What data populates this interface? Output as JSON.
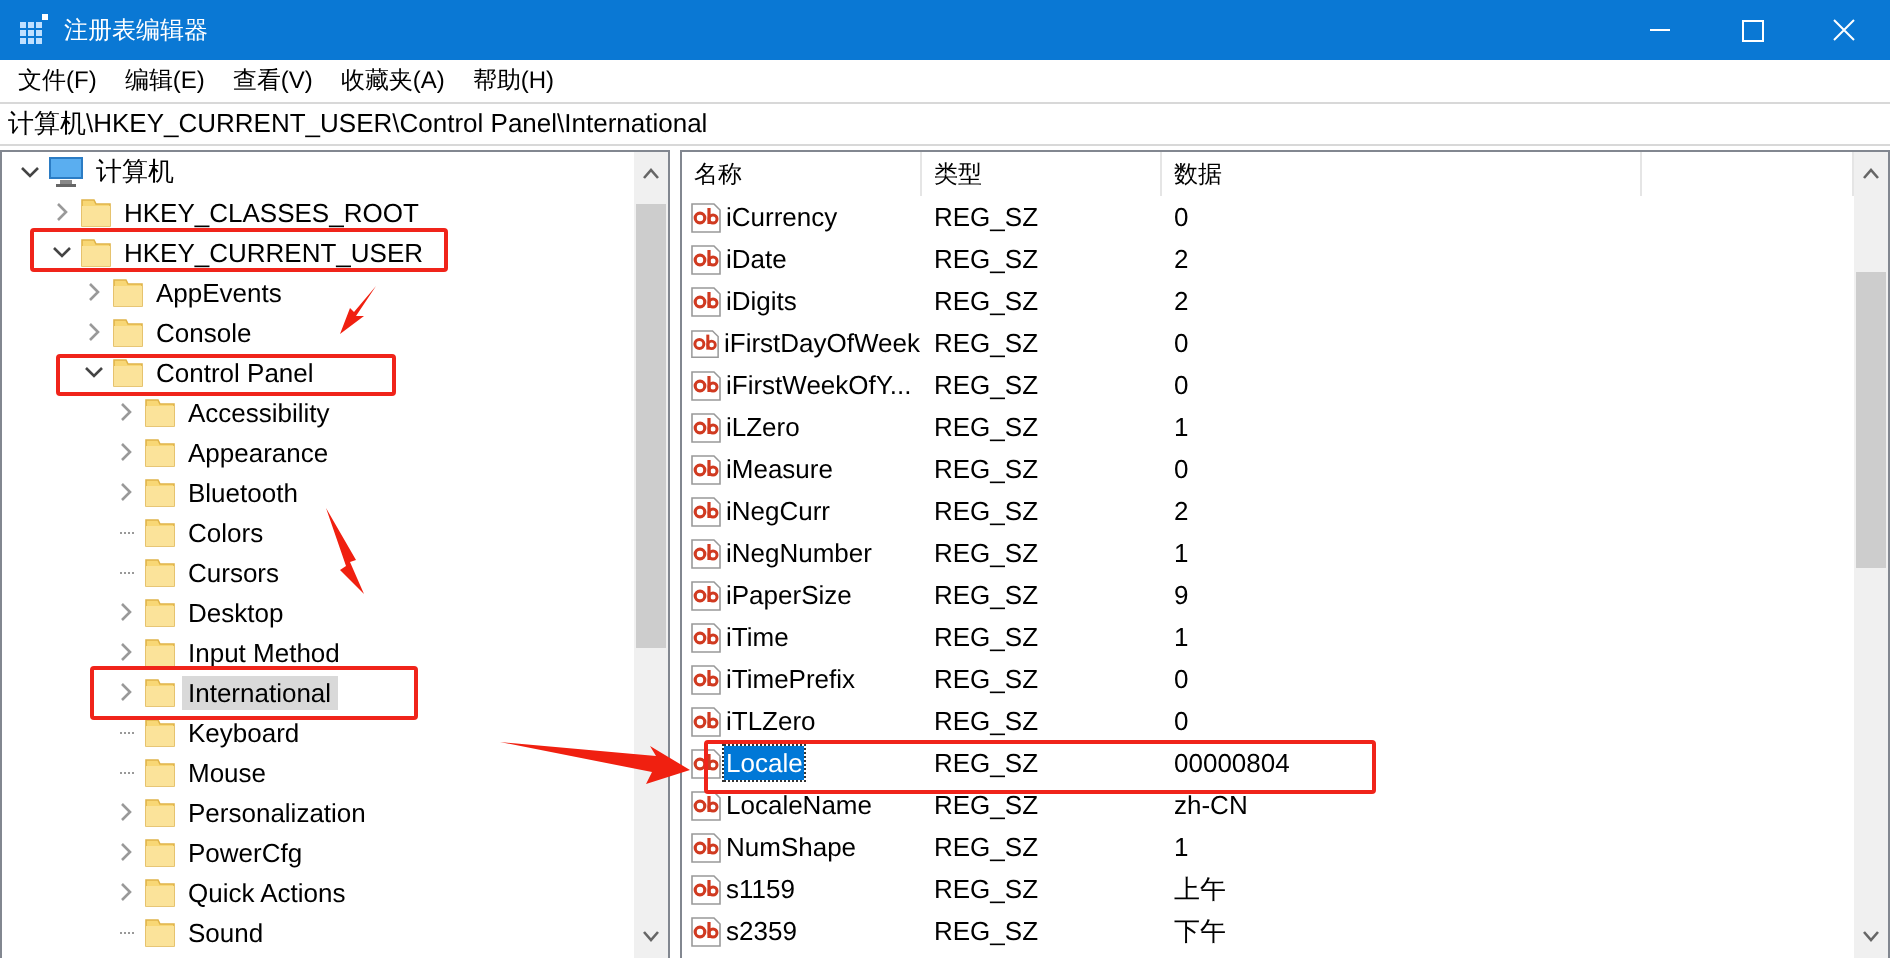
{
  "window": {
    "title": "注册表编辑器"
  },
  "menu": [
    "文件(F)",
    "编辑(E)",
    "查看(V)",
    "收藏夹(A)",
    "帮助(H)"
  ],
  "address": "计算机\\HKEY_CURRENT_USER\\Control Panel\\International",
  "tree": [
    {
      "label": "计算机",
      "kind": "computer",
      "expandable": true,
      "expanded": true,
      "selected": false,
      "children": [
        {
          "label": "HKEY_CLASSES_ROOT",
          "kind": "folder",
          "expandable": true,
          "expanded": false,
          "selected": false
        },
        {
          "label": "HKEY_CURRENT_USER",
          "kind": "folder",
          "expandable": true,
          "expanded": true,
          "selected": false,
          "children": [
            {
              "label": "AppEvents",
              "kind": "folder",
              "expandable": true,
              "expanded": false,
              "selected": false
            },
            {
              "label": "Console",
              "kind": "folder",
              "expandable": true,
              "expanded": false,
              "selected": false
            },
            {
              "label": "Control Panel",
              "kind": "folder",
              "expandable": true,
              "expanded": true,
              "selected": false,
              "children": [
                {
                  "label": "Accessibility",
                  "kind": "folder",
                  "expandable": true,
                  "expanded": false,
                  "selected": false
                },
                {
                  "label": "Appearance",
                  "kind": "folder",
                  "expandable": true,
                  "expanded": false,
                  "selected": false
                },
                {
                  "label": "Bluetooth",
                  "kind": "folder",
                  "expandable": true,
                  "expanded": false,
                  "selected": false
                },
                {
                  "label": "Colors",
                  "kind": "folder",
                  "expandable": false,
                  "selected": false
                },
                {
                  "label": "Cursors",
                  "kind": "folder",
                  "expandable": false,
                  "selected": false
                },
                {
                  "label": "Desktop",
                  "kind": "folder",
                  "expandable": true,
                  "expanded": false,
                  "selected": false
                },
                {
                  "label": "Input Method",
                  "kind": "folder",
                  "expandable": true,
                  "expanded": false,
                  "selected": false
                },
                {
                  "label": "International",
                  "kind": "folder",
                  "expandable": true,
                  "expanded": false,
                  "selected": true
                },
                {
                  "label": "Keyboard",
                  "kind": "folder",
                  "expandable": false,
                  "selected": false
                },
                {
                  "label": "Mouse",
                  "kind": "folder",
                  "expandable": false,
                  "selected": false
                },
                {
                  "label": "Personalization",
                  "kind": "folder",
                  "expandable": true,
                  "expanded": false,
                  "selected": false
                },
                {
                  "label": "PowerCfg",
                  "kind": "folder",
                  "expandable": true,
                  "expanded": false,
                  "selected": false
                },
                {
                  "label": "Quick Actions",
                  "kind": "folder",
                  "expandable": true,
                  "expanded": false,
                  "selected": false
                },
                {
                  "label": "Sound",
                  "kind": "folder",
                  "expandable": false,
                  "selected": false
                }
              ]
            }
          ]
        }
      ]
    }
  ],
  "table": {
    "columns": [
      "名称",
      "类型",
      "数据"
    ],
    "rows": [
      {
        "name": "iCurrency",
        "type": "REG_SZ",
        "data": "0",
        "selected": false
      },
      {
        "name": "iDate",
        "type": "REG_SZ",
        "data": "2",
        "selected": false
      },
      {
        "name": "iDigits",
        "type": "REG_SZ",
        "data": "2",
        "selected": false
      },
      {
        "name": "iFirstDayOfWeek",
        "type": "REG_SZ",
        "data": "0",
        "selected": false
      },
      {
        "name": "iFirstWeekOfY...",
        "type": "REG_SZ",
        "data": "0",
        "selected": false
      },
      {
        "name": "iLZero",
        "type": "REG_SZ",
        "data": "1",
        "selected": false
      },
      {
        "name": "iMeasure",
        "type": "REG_SZ",
        "data": "0",
        "selected": false
      },
      {
        "name": "iNegCurr",
        "type": "REG_SZ",
        "data": "2",
        "selected": false
      },
      {
        "name": "iNegNumber",
        "type": "REG_SZ",
        "data": "1",
        "selected": false
      },
      {
        "name": "iPaperSize",
        "type": "REG_SZ",
        "data": "9",
        "selected": false
      },
      {
        "name": "iTime",
        "type": "REG_SZ",
        "data": "1",
        "selected": false
      },
      {
        "name": "iTimePrefix",
        "type": "REG_SZ",
        "data": "0",
        "selected": false
      },
      {
        "name": "iTLZero",
        "type": "REG_SZ",
        "data": "0",
        "selected": false
      },
      {
        "name": "Locale",
        "type": "REG_SZ",
        "data": "00000804",
        "selected": true
      },
      {
        "name": "LocaleName",
        "type": "REG_SZ",
        "data": "zh-CN",
        "selected": false
      },
      {
        "name": "NumShape",
        "type": "REG_SZ",
        "data": "1",
        "selected": false
      },
      {
        "name": "s1159",
        "type": "REG_SZ",
        "data": "上午",
        "selected": false
      },
      {
        "name": "s2359",
        "type": "REG_SZ",
        "data": "下午",
        "selected": false
      }
    ]
  }
}
